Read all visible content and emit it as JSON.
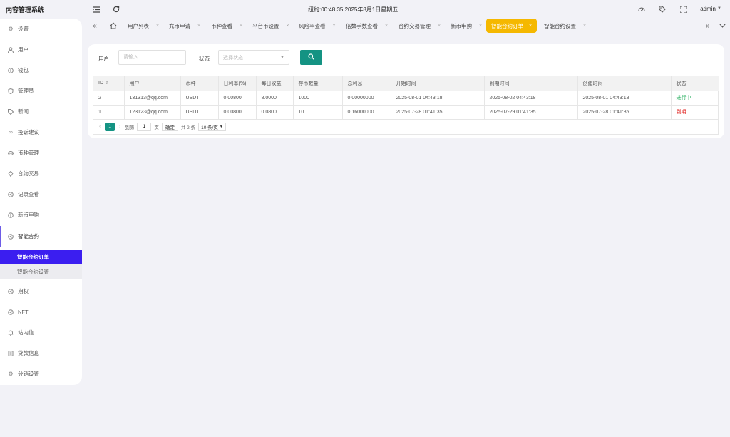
{
  "app_title": "内容管理系统",
  "header": {
    "clock": "纽约:00:48:35 2025年8月1日星期五",
    "user": "admin"
  },
  "sidebar": {
    "items": [
      {
        "label": "设置",
        "icon": "gear-icon"
      },
      {
        "label": "用户",
        "icon": "user-icon"
      },
      {
        "label": "钱包",
        "icon": "wallet-icon"
      },
      {
        "label": "管理员",
        "icon": "shield-icon"
      },
      {
        "label": "新闻",
        "icon": "tag-icon"
      },
      {
        "label": "投诉建议",
        "icon": "link-icon"
      },
      {
        "label": "币种管理",
        "icon": "coin-icon"
      },
      {
        "label": "合约交易",
        "icon": "diamond-icon"
      },
      {
        "label": "记录查看",
        "icon": "record-icon"
      },
      {
        "label": "新币申购",
        "icon": "currency-icon"
      },
      {
        "label": "智能合约",
        "icon": "contract-icon"
      },
      {
        "label": "期权",
        "icon": "option-icon"
      },
      {
        "label": "NFT",
        "icon": "nft-icon"
      },
      {
        "label": "站内信",
        "icon": "bell-icon"
      },
      {
        "label": "贷款信息",
        "icon": "loan-icon"
      },
      {
        "label": "分销设置",
        "icon": "settings-icon"
      }
    ],
    "submenu": [
      {
        "label": "智能合约订单"
      },
      {
        "label": "智能合约设置"
      }
    ]
  },
  "tabs": [
    {
      "label": "用户列表"
    },
    {
      "label": "充币申请"
    },
    {
      "label": "币种查看"
    },
    {
      "label": "平台币设置"
    },
    {
      "label": "风险率查看"
    },
    {
      "label": "倍数手数查看"
    },
    {
      "label": "合约交易管理"
    },
    {
      "label": "新币申购"
    },
    {
      "label": "智能合约订单"
    },
    {
      "label": "智能合约设置"
    }
  ],
  "filters": {
    "user_label": "用户",
    "user_placeholder": "请输入",
    "status_label": "状态",
    "status_placeholder": "选择状态"
  },
  "table": {
    "columns": [
      "ID",
      "用户",
      "币种",
      "日利率(%)",
      "每日收益",
      "存币数量",
      "总利息",
      "开始时间",
      "到期时间",
      "创建时间",
      "状态"
    ],
    "rows": [
      {
        "id": "2",
        "user": "131313@qq.com",
        "coin": "USDT",
        "rate": "0.00800",
        "daily": "8.0000",
        "amount": "1000",
        "interest": "0.00000000",
        "start": "2025-08-01 04:43:18",
        "end": "2025-08-02 04:43:18",
        "created": "2025-08-01 04:43:18",
        "status": "进行中"
      },
      {
        "id": "1",
        "user": "123123@qq.com",
        "coin": "USDT",
        "rate": "0.00800",
        "daily": "0.0800",
        "amount": "10",
        "interest": "0.16000000",
        "start": "2025-07-28 01:41:35",
        "end": "2025-07-29 01:41:35",
        "created": "2025-07-28 01:41:35",
        "status": "到期"
      }
    ]
  },
  "pager": {
    "current": "1",
    "goto_label": "到第",
    "page_input": "1",
    "page_unit": "页",
    "confirm": "确定",
    "total": "共 2 条",
    "page_size": "10 条/页"
  },
  "colors": {
    "accent_purple": "#3b1ef0",
    "tab_active": "#f5b800",
    "teal": "#149383",
    "running": "#1aaa55",
    "expired": "#e0221f"
  }
}
